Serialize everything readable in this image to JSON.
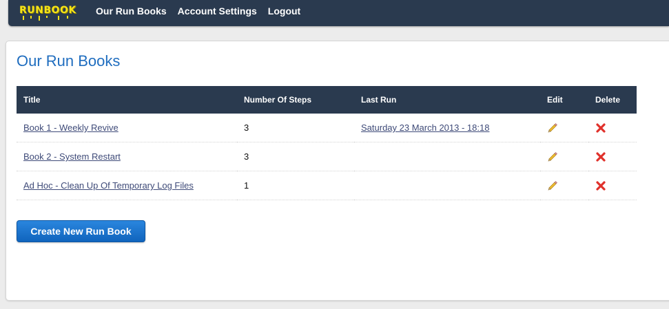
{
  "header": {
    "logo_text": "RUNBOOK",
    "nav": [
      {
        "label": "Our Run Books"
      },
      {
        "label": "Account Settings"
      },
      {
        "label": "Logout"
      }
    ]
  },
  "main": {
    "title": "Our Run Books",
    "table": {
      "columns": [
        "Title",
        "Number Of Steps",
        "Last Run",
        "Edit",
        "Delete"
      ],
      "rows": [
        {
          "title": "Book 1 - Weekly Revive",
          "steps": "3",
          "last_run": "Saturday 23 March 2013 - 18:18",
          "edit_icon": "pencil-icon",
          "delete_icon": "red-x-icon"
        },
        {
          "title": "Book 2 - System Restart",
          "steps": "3",
          "last_run": "",
          "edit_icon": "pencil-icon",
          "delete_icon": "red-x-icon"
        },
        {
          "title": "Ad Hoc - Clean Up Of Temporary Log Files",
          "steps": "1",
          "last_run": "",
          "edit_icon": "pencil-icon",
          "delete_icon": "red-x-icon"
        }
      ]
    },
    "create_button_label": "Create New Run Book"
  },
  "colors": {
    "header_bg": "#2a3a4f",
    "logo": "#f6e418",
    "title_blue": "#1f6dbf",
    "link": "#3e4a78",
    "button_blue": "#1a73cc",
    "delete_red": "#e0312b",
    "pencil_yellow": "#f2c233"
  }
}
